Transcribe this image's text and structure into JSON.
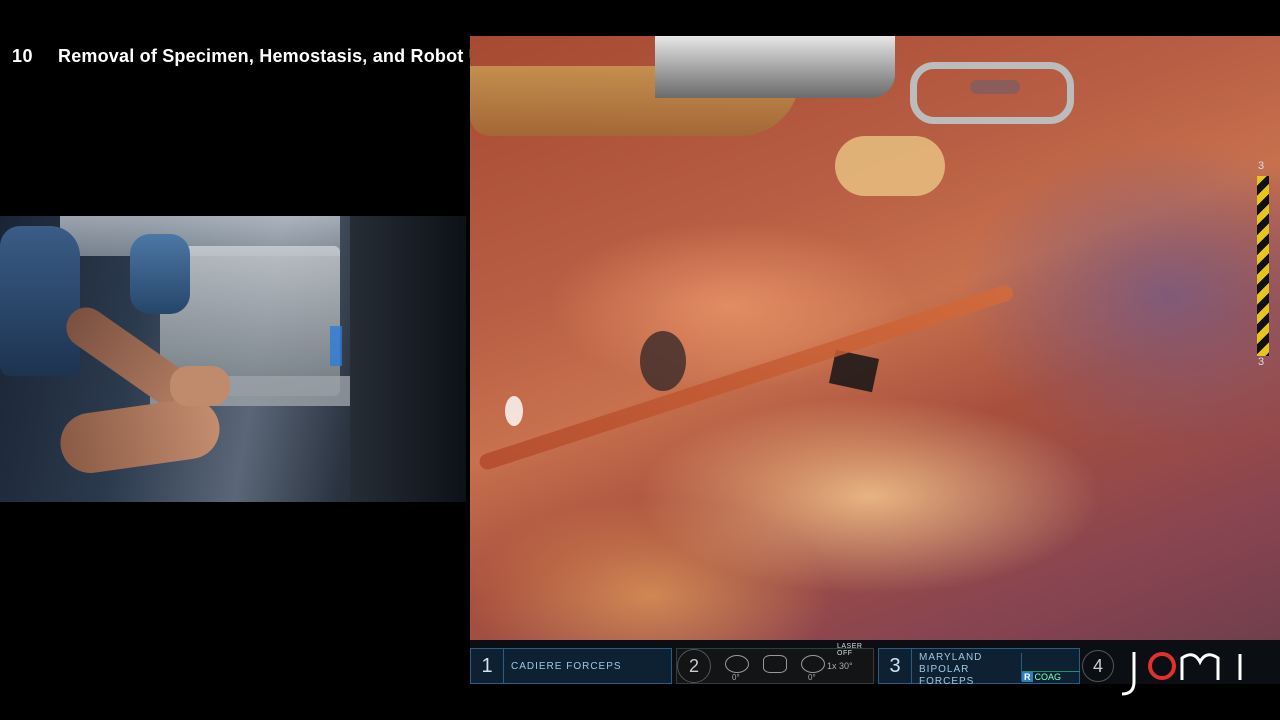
{
  "chapter": {
    "number": "10",
    "title": "Removal of Specimen, Hemostasis, and Robot Undocking"
  },
  "hud": {
    "arm1": {
      "number": "1",
      "label": "CADIERE FORCEPS"
    },
    "camera": {
      "number": "2",
      "laser": "LASER OFF",
      "angle_left": "0°",
      "angle_right": "0°",
      "zoom": "1x  30°"
    },
    "arm3": {
      "number": "3",
      "label_line1": "MARYLAND",
      "label_line2": "BIPOLAR FORCEPS",
      "mode_tag": "R",
      "mode": "COAG"
    },
    "arm4": {
      "number": "4"
    }
  },
  "depth_scale": {
    "top": "3",
    "bottom": "3"
  },
  "logo": {
    "text": "jomi",
    "accent_color": "#e0312a"
  }
}
